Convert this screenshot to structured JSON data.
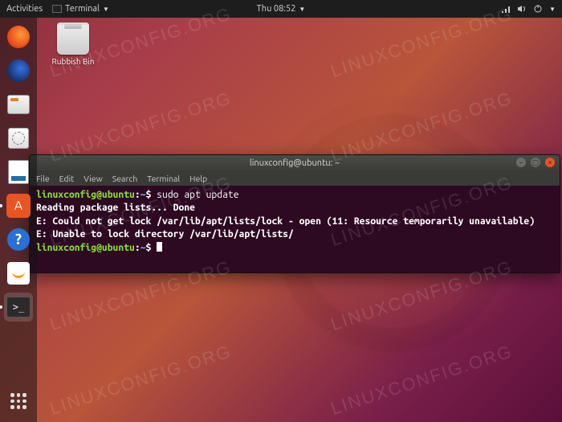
{
  "topbar": {
    "activities": "Activities",
    "app_menu_label": "Terminal",
    "clock": "Thu 08:52"
  },
  "desktop": {
    "trash_label": "Rubbish Bin"
  },
  "dock": {
    "items": [
      {
        "name": "firefox"
      },
      {
        "name": "thunderbird"
      },
      {
        "name": "files"
      },
      {
        "name": "rhythmbox"
      },
      {
        "name": "libreoffice-writer"
      },
      {
        "name": "ubuntu-software"
      },
      {
        "name": "help"
      },
      {
        "name": "amazon"
      },
      {
        "name": "terminal"
      }
    ]
  },
  "terminal": {
    "title": "linuxconfig@ubuntu: ~",
    "menu": {
      "file": "File",
      "edit": "Edit",
      "view": "View",
      "search": "Search",
      "terminal": "Terminal",
      "help": "Help"
    },
    "prompt": {
      "user_host": "linuxconfig@ubuntu",
      "colon": ":",
      "path": "~",
      "symbol": "$"
    },
    "lines": {
      "cmd1": "sudo apt update",
      "out1": "Reading package lists... Done",
      "out2": "E: Could not get lock /var/lib/apt/lists/lock - open (11: Resource temporarily unavailable)",
      "out3": "E: Unable to lock directory /var/lib/apt/lists/"
    }
  },
  "watermark": "LINUXCONFIG.ORG"
}
